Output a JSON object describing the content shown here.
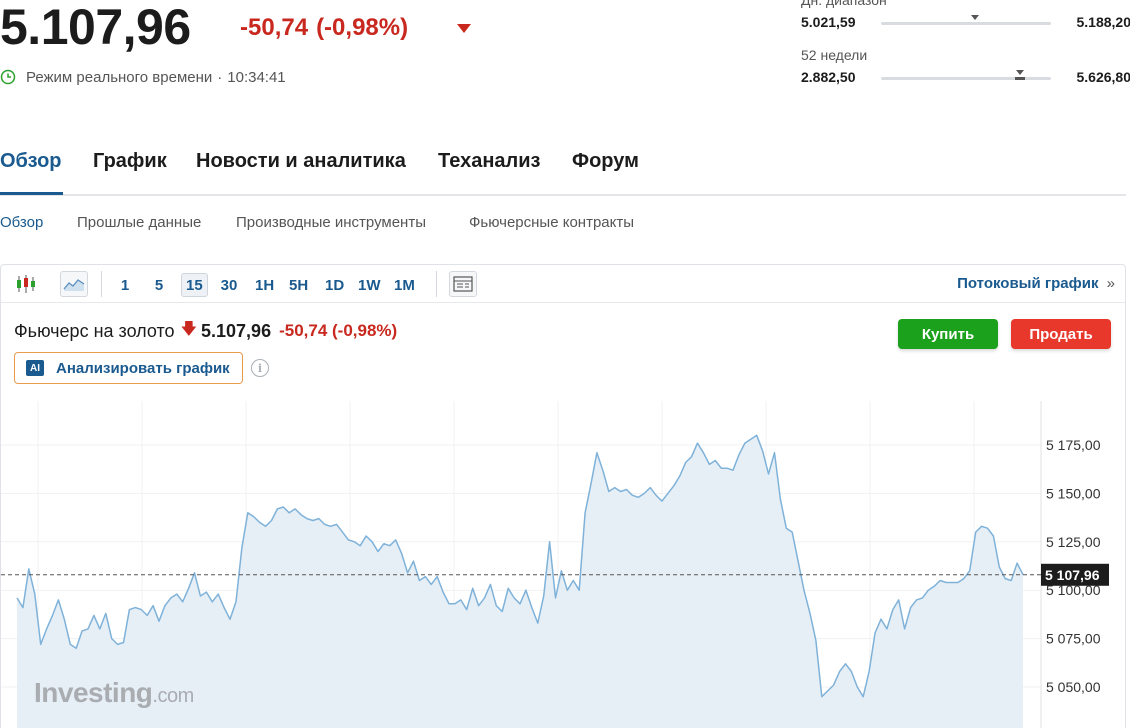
{
  "quote": {
    "price": "5.107,96",
    "change": "-50,74",
    "change_pct": "(-0,98%)",
    "direction": "down",
    "realtime_label": "Режим реального времени",
    "separator": "·",
    "time": "10:34:41"
  },
  "ranges": {
    "day": {
      "title": "Дн. диапазон",
      "low": "5.021,59",
      "high": "5.188,20",
      "position": 0.55
    },
    "week52": {
      "title": "52 недели",
      "low": "2.882,50",
      "high": "5.626,80",
      "position": 0.82
    }
  },
  "tabs": [
    {
      "label": "Обзор",
      "active": true
    },
    {
      "label": "График",
      "active": false
    },
    {
      "label": "Новости и аналитика",
      "active": false
    },
    {
      "label": "Теханализ",
      "active": false
    },
    {
      "label": "Форум",
      "active": false
    }
  ],
  "subtabs": [
    {
      "label": "Обзор",
      "active": true
    },
    {
      "label": "Прошлые данные",
      "active": false
    },
    {
      "label": "Производные инструменты",
      "active": false
    },
    {
      "label": "Фьючерсные контракты",
      "active": false
    }
  ],
  "toolbar": {
    "icons": [
      "candlestick-icon",
      "area-chart-icon",
      "layout-icon"
    ],
    "timeframes": [
      "1",
      "5",
      "15",
      "30",
      "1H",
      "5H",
      "1D",
      "1W",
      "1M"
    ],
    "active_timeframe": "15",
    "stream_link": "Потоковый график",
    "stream_arrow": "»"
  },
  "instrument": {
    "name": "Фьючерс на золото",
    "arrow": "🡇",
    "last": "5.107,96",
    "change": "-50,74 (-0,98%)"
  },
  "actions": {
    "buy": "Купить",
    "sell": "Продать"
  },
  "ai": {
    "badge": "AI",
    "label": "Анализировать график",
    "info": "i"
  },
  "watermark": {
    "brand": "Investing",
    "domain": ".com"
  },
  "colors": {
    "line": "#7fb2d9",
    "area": "#e6eef6",
    "negative": "#c8281e",
    "accent": "#1a5a8f",
    "buy": "#1ca11c",
    "sell": "#e8382c"
  },
  "chart_data": {
    "type": "area",
    "current_value": 5107.96,
    "current_label": "5 107,96",
    "y_ticks": [
      {
        "value": 5175,
        "label": "5 175,00"
      },
      {
        "value": 5150,
        "label": "5 150,00"
      },
      {
        "value": 5125,
        "label": "5 125,00"
      },
      {
        "value": 5100,
        "label": "5 100,00"
      },
      {
        "value": 5075,
        "label": "5 075,00"
      },
      {
        "value": 5050,
        "label": "5 050,00"
      }
    ],
    "ylim": [
      5030,
      5190
    ],
    "grid": true,
    "values": [
      5096,
      5091,
      5111,
      5098,
      5072,
      5080,
      5087,
      5095,
      5085,
      5072,
      5070,
      5079,
      5080,
      5087,
      5080,
      5088,
      5075,
      5072,
      5073,
      5090,
      5091,
      5090,
      5087,
      5092,
      5084,
      5092,
      5096,
      5098,
      5094,
      5101,
      5109,
      5097,
      5099,
      5094,
      5098,
      5091,
      5085,
      5094,
      5122,
      5140,
      5138,
      5135,
      5133,
      5136,
      5142,
      5143,
      5140,
      5142,
      5139,
      5137,
      5136,
      5137,
      5134,
      5133,
      5134,
      5130,
      5126,
      5125,
      5123,
      5128,
      5125,
      5120,
      5124,
      5123,
      5126,
      5119,
      5109,
      5115,
      5105,
      5107,
      5103,
      5107,
      5099,
      5093,
      5093,
      5095,
      5090,
      5101,
      5092,
      5096,
      5103,
      5092,
      5089,
      5101,
      5096,
      5093,
      5100,
      5091,
      5083,
      5097,
      5125,
      5096,
      5110,
      5100,
      5105,
      5100,
      5140,
      5155,
      5171,
      5162,
      5151,
      5153,
      5151,
      5152,
      5149,
      5148,
      5150,
      5153,
      5149,
      5146,
      5150,
      5154,
      5159,
      5166,
      5169,
      5176,
      5171,
      5165,
      5167,
      5163,
      5163,
      5162,
      5170,
      5176,
      5178,
      5180,
      5172,
      5160,
      5171,
      5147,
      5132,
      5130,
      5115,
      5100,
      5088,
      5074,
      5045,
      5048,
      5051,
      5058,
      5062,
      5058,
      5050,
      5045,
      5058,
      5078,
      5085,
      5080,
      5090,
      5095,
      5080,
      5091,
      5095,
      5096,
      5100,
      5102,
      5105,
      5104,
      5104,
      5104,
      5106,
      5110,
      5130,
      5133,
      5132,
      5128,
      5112,
      5106,
      5105,
      5114,
      5108
    ]
  }
}
